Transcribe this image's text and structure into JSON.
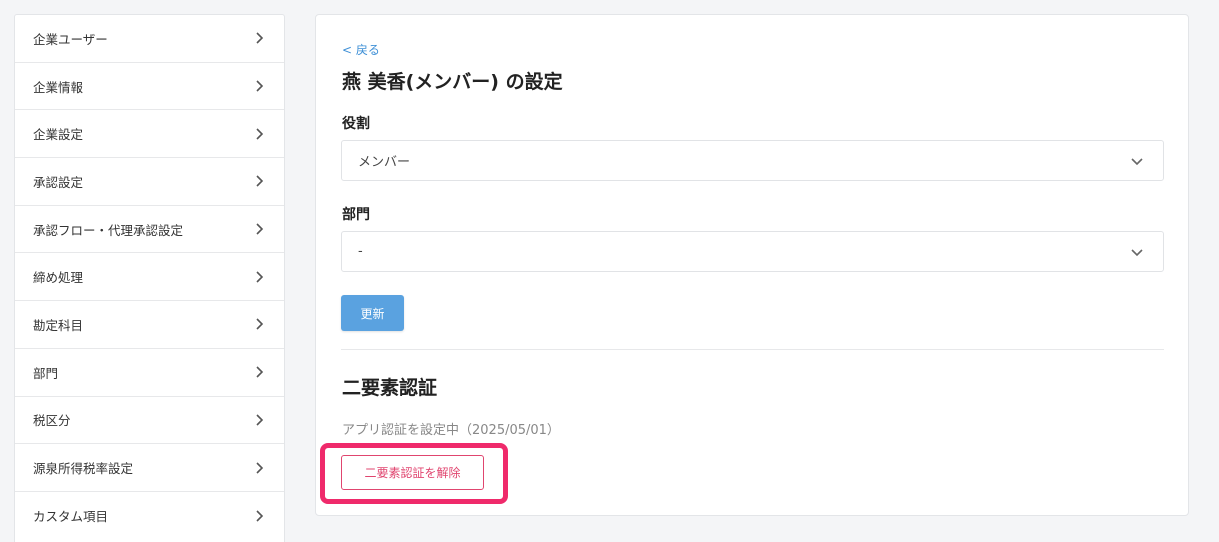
{
  "sidebar": {
    "items": [
      {
        "label": "企業ユーザー"
      },
      {
        "label": "企業情報"
      },
      {
        "label": "企業設定"
      },
      {
        "label": "承認設定"
      },
      {
        "label": "承認フロー・代理承認設定"
      },
      {
        "label": "締め処理"
      },
      {
        "label": "勘定科目"
      },
      {
        "label": "部門"
      },
      {
        "label": "税区分"
      },
      {
        "label": "源泉所得税率設定"
      },
      {
        "label": "カスタム項目"
      }
    ]
  },
  "main": {
    "back_link": "< 戻る",
    "title": "燕 美香(メンバー) の設定",
    "role": {
      "label": "役割",
      "value": "メンバー"
    },
    "department": {
      "label": "部門",
      "value": "-"
    },
    "update_button": "更新",
    "two_factor": {
      "title": "二要素認証",
      "status": "アプリ認証を設定中（2025/05/01）",
      "disable_button": "二要素認証を解除"
    }
  },
  "colors": {
    "accent_blue": "#5aa2e0",
    "link_blue": "#3d8fd6",
    "danger_pink": "#e0456f",
    "highlight": "#ef2a6b"
  }
}
